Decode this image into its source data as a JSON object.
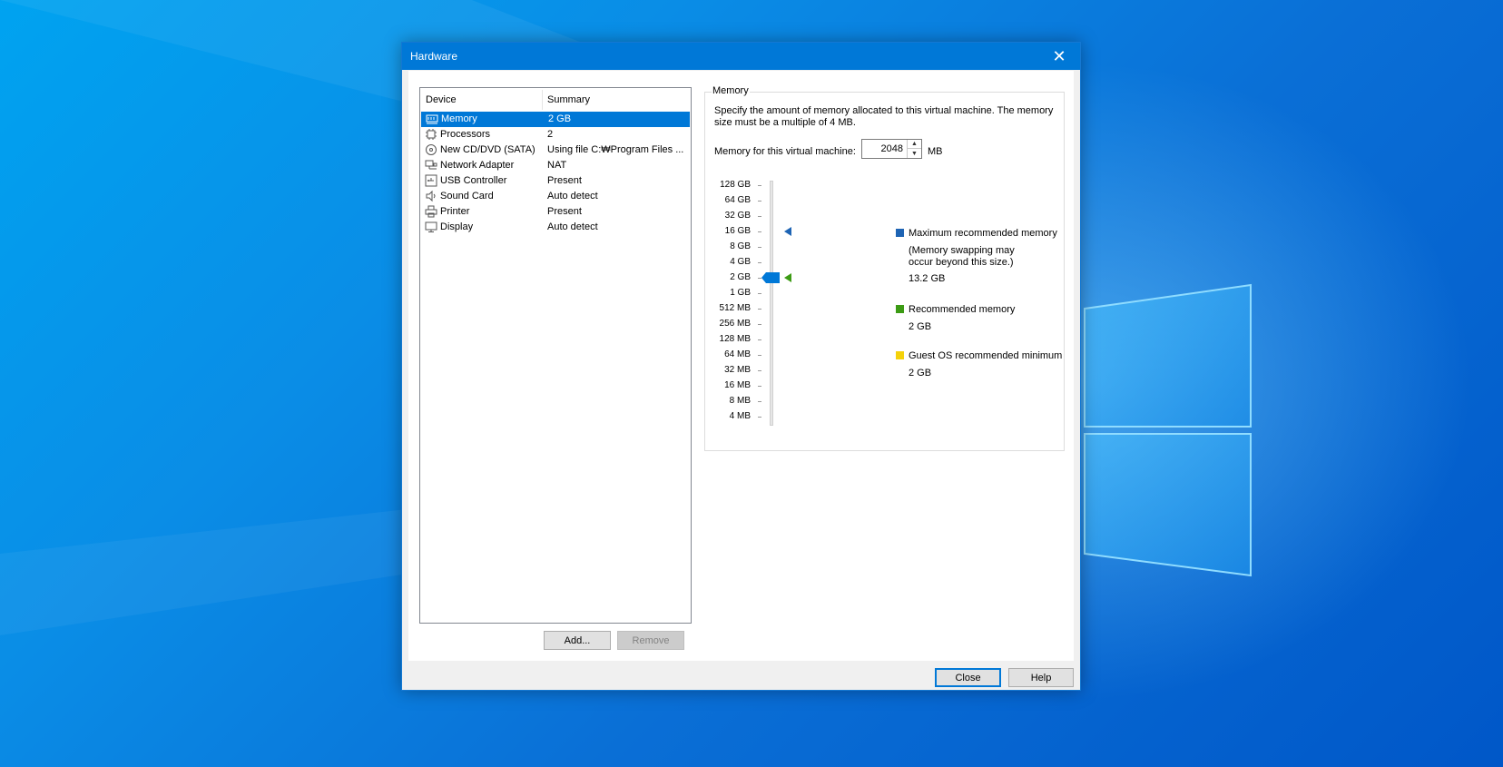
{
  "dialog": {
    "title": "Hardware",
    "close_icon": "close-icon"
  },
  "device_list": {
    "columns": {
      "device": "Device",
      "summary": "Summary"
    },
    "rows": [
      {
        "device": "Memory",
        "summary": "2 GB",
        "icon": "memory-icon",
        "selected": true
      },
      {
        "device": "Processors",
        "summary": "2",
        "icon": "processor-icon",
        "selected": false
      },
      {
        "device": "New CD/DVD (SATA)",
        "summary": "Using file C:₩Program Files ...",
        "icon": "cd-dvd-icon",
        "selected": false
      },
      {
        "device": "Network Adapter",
        "summary": "NAT",
        "icon": "network-adapter-icon",
        "selected": false
      },
      {
        "device": "USB Controller",
        "summary": "Present",
        "icon": "usb-icon",
        "selected": false
      },
      {
        "device": "Sound Card",
        "summary": "Auto detect",
        "icon": "speaker-icon",
        "selected": false
      },
      {
        "device": "Printer",
        "summary": "Present",
        "icon": "printer-icon",
        "selected": false
      },
      {
        "device": "Display",
        "summary": "Auto detect",
        "icon": "monitor-icon",
        "selected": false
      }
    ],
    "add_label": "Add...",
    "remove_label": "Remove"
  },
  "memory": {
    "group_title": "Memory",
    "description": "Specify the amount of memory allocated to this virtual machine. The memory size must be a multiple of 4 MB.",
    "field_label": "Memory for this virtual machine:",
    "value": "2048",
    "unit": "MB",
    "scale": [
      "128 GB",
      "64 GB",
      "32 GB",
      "16 GB",
      "8 GB",
      "4 GB",
      "2 GB",
      "1 GB",
      "512 MB",
      "256 MB",
      "128 MB",
      "64 MB",
      "32 MB",
      "16 MB",
      "8 MB",
      "4 MB"
    ],
    "slider_value": "2 GB",
    "max_marker": "16 GB",
    "recommended_marker": "2 GB",
    "legend": {
      "max_title": "Maximum recommended memory",
      "max_note_line1": "(Memory swapping may",
      "max_note_line2": "occur beyond this size.)",
      "max_value": "13.2 GB",
      "rec_title": "Recommended memory",
      "rec_value": "2 GB",
      "guest_title": "Guest OS recommended minimum",
      "guest_value": "2 GB"
    },
    "colors": {
      "max": "#1e64b4",
      "recommended": "#3c9b14",
      "guest": "#f5d20a"
    }
  },
  "footer": {
    "close_label": "Close",
    "help_label": "Help"
  }
}
